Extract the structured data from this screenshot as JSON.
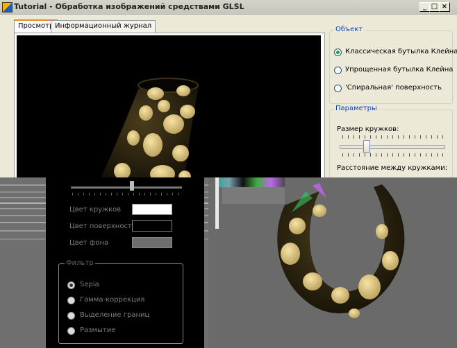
{
  "window": {
    "title": "Tutorial - Обработка изображений средствами GLSL",
    "caption_buttons": [
      "_",
      "□",
      "×"
    ]
  },
  "tabs": [
    {
      "label": "Просмотр",
      "active": true
    },
    {
      "label": "Информационный журнал",
      "active": false
    }
  ],
  "object_group": {
    "title": "Объект",
    "options": [
      {
        "label": "Классическая бутылка Клейна",
        "selected": true
      },
      {
        "label": "Упрощенная бутылка Клейна",
        "selected": false
      },
      {
        "label": "'Спиральная' поверхность",
        "selected": false
      }
    ]
  },
  "params_group": {
    "title": "Параметры",
    "spot_size_label": "Размер кружков:",
    "spot_size_value": 0.25,
    "spot_distance_label": "Расстояние между кружками:",
    "spot_distance_value": 0.55
  },
  "colors_section": {
    "spot_color_label": "Цвет кружков",
    "surface_color_label": "Цвет поверхности",
    "background_color_label": "Цвет фона",
    "spot_color": "#ffffff",
    "surface_color": "#000000",
    "background_color": "#6e6e6e"
  },
  "filter_group": {
    "title": "Фильтр",
    "options": [
      {
        "label": "Sepia",
        "selected": true
      },
      {
        "label": "Гамма-коррекция",
        "selected": false
      },
      {
        "label": "Выделение границ",
        "selected": false
      },
      {
        "label": "Размытие",
        "selected": false
      }
    ]
  },
  "accent_colors": {
    "spots": "#e3cf8e",
    "surface": "#26200f",
    "glitch_gray": "#6f6f6f"
  }
}
